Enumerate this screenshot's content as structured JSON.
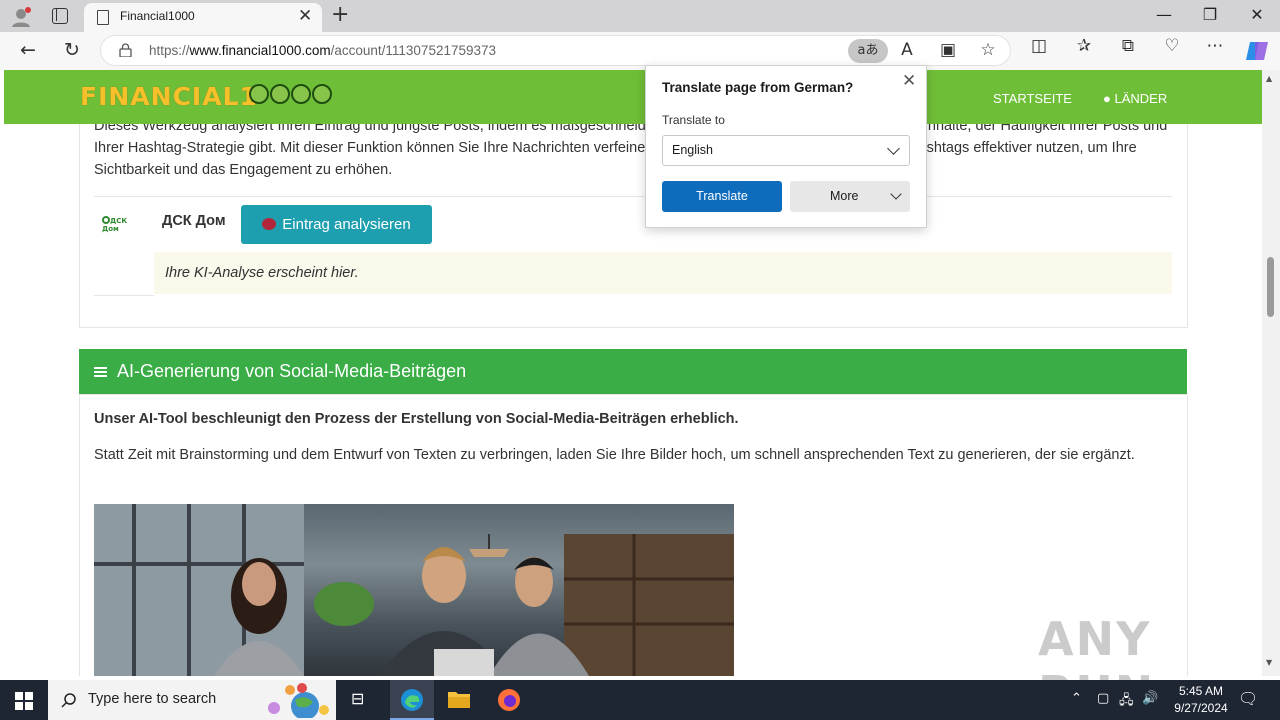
{
  "browser": {
    "tab_title": "Financial1000",
    "url_prefix": "https://",
    "url_host": "www.financial1000.com",
    "url_path": "/account/111307521759373",
    "translate_button": "aあ",
    "window_controls": [
      "—",
      "❐",
      "✕"
    ]
  },
  "site": {
    "logo": "FINANCIAL1",
    "nav": {
      "home": "STARTSEITE",
      "countries": "LÄNDER"
    }
  },
  "analysis": {
    "description": "Dieses Werkzeug analysiert Ihren Eintrag und jüngste Posts, indem es maßgeschneiderte Empfehlungen zur Verbesserung Ihrer Inhalte, der Häufigkeit Ihrer Posts und Ihrer Hashtag-Strategie gibt. Mit dieser Funktion können Sie Ihre Nachrichten verfeinern, Ihre Zielgruppe besser erreichen und Hashtags effektiver nutzen, um Ihre Sichtbarkeit und das Engagement zu erhöhen.",
    "company_logo_text": "ДСК Дом",
    "company_name": "ДСК Дом",
    "analyze_button": "Eintrag analysieren",
    "result_placeholder": "Ihre KI-Analyse erscheint hier."
  },
  "generation": {
    "section_title": "AI-Generierung von Social-Media-Beiträgen",
    "lead": "Unser AI-Tool beschleunigt den Prozess der Erstellung von Social-Media-Beiträgen erheblich.",
    "body": "Statt Zeit mit Brainstorming und dem Entwurf von Texten zu verbringen, laden Sie Ihre Bilder hoch, um schnell ansprechenden Text zu generieren, der sie ergänzt."
  },
  "translate_popup": {
    "title": "Translate page from German?",
    "label": "Translate to",
    "selected_language": "English",
    "translate_button": "Translate",
    "more_button": "More"
  },
  "watermark": "ANY RUN",
  "taskbar": {
    "search_placeholder": "Type here to search",
    "time": "5:45 AM",
    "date": "9/27/2024"
  }
}
